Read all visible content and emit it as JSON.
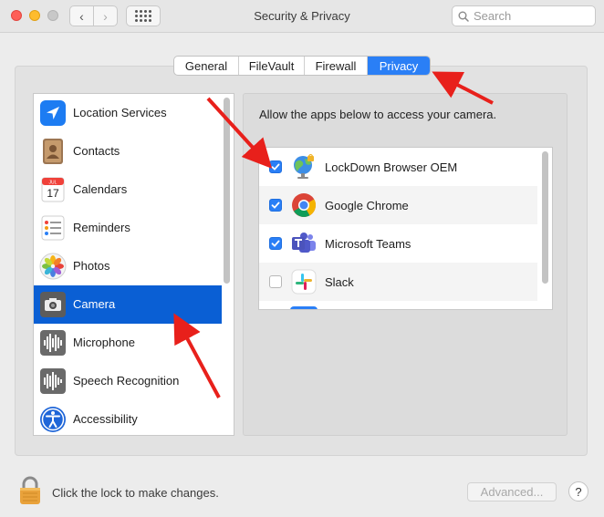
{
  "window": {
    "title": "Security & Privacy",
    "search_placeholder": "Search"
  },
  "tabs": [
    {
      "label": "General",
      "selected": false
    },
    {
      "label": "FileVault",
      "selected": false
    },
    {
      "label": "Firewall",
      "selected": false
    },
    {
      "label": "Privacy",
      "selected": true
    }
  ],
  "categories": [
    {
      "label": "Location Services",
      "icon": "location-arrow-icon"
    },
    {
      "label": "Contacts",
      "icon": "contacts-book-icon"
    },
    {
      "label": "Calendars",
      "icon": "calendar-icon",
      "icon_text": {
        "month": "JUL",
        "day": "17"
      }
    },
    {
      "label": "Reminders",
      "icon": "reminders-list-icon"
    },
    {
      "label": "Photos",
      "icon": "photos-flower-icon"
    },
    {
      "label": "Camera",
      "icon": "camera-icon",
      "selected": true
    },
    {
      "label": "Microphone",
      "icon": "microphone-waveform-icon"
    },
    {
      "label": "Speech Recognition",
      "icon": "speech-waveform-icon"
    },
    {
      "label": "Accessibility",
      "icon": "accessibility-icon"
    }
  ],
  "camera_pane": {
    "description": "Allow the apps below to access your camera.",
    "apps": [
      {
        "label": "LockDown Browser OEM",
        "checked": true,
        "icon": "lockdown-browser-globe-icon"
      },
      {
        "label": "Google Chrome",
        "checked": true,
        "icon": "chrome-icon"
      },
      {
        "label": "Microsoft Teams",
        "checked": true,
        "icon": "teams-icon"
      },
      {
        "label": "Slack",
        "checked": false,
        "icon": "slack-icon"
      }
    ]
  },
  "footer": {
    "lock_text": "Click the lock to make changes.",
    "advanced_label": "Advanced...",
    "help_label": "?"
  },
  "colors": {
    "accent": "#2a7ff6",
    "selection": "#0a5fd4",
    "annotation_arrow": "#e8201b"
  }
}
